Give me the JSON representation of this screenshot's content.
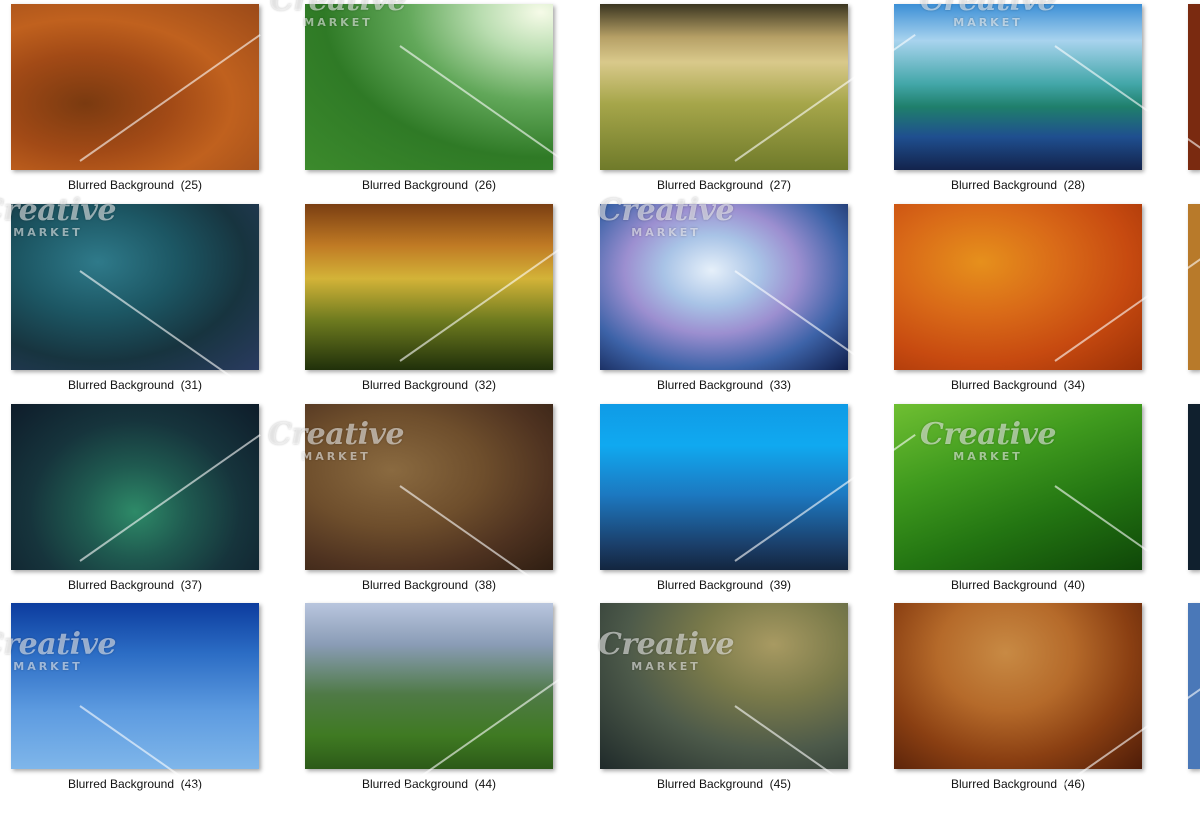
{
  "gallery": {
    "items": [
      {
        "label": "Blurred Background  (25)",
        "gradient": "radial-gradient(ellipse at 30% 60%, #7a3a10 0%, #a24a16 35%, #c0611e 60%, #9b4a19 100%)"
      },
      {
        "label": "Blurred Background  (26)",
        "gradient": "radial-gradient(ellipse at 95% 5%, #f6fbe8 0%, #b9ddb0 18%, #62a85a 40%, #2f7a26 65%, #3c8a2c 100%)"
      },
      {
        "label": "Blurred Background  (27)",
        "gradient": "linear-gradient(180deg, #3a3520 0%, #b6a066 20%, #d9c98b 35%, #a6a64a 60%, #6f7a2a 100%)"
      },
      {
        "label": "Blurred Background  (28)",
        "gradient": "linear-gradient(180deg, #3c8fd6 0%, #a8d3ee 22%, #43a7a9 48%, #1f7f6b 62%, #1f4f8f 80%, #13234c 100%)"
      },
      {
        "label": "Blurred Background  (31)",
        "gradient": "radial-gradient(ellipse at 35% 35%, #2f7a8a 0%, #1c5663 35%, #17343f 65%, #2a3b60 100%)"
      },
      {
        "label": "Blurred Background  (32)",
        "gradient": "linear-gradient(180deg, #7a3e12 0%, #c07a24 25%, #d3b338 45%, #6e7b1f 70%, #20300a 100%)"
      },
      {
        "label": "Blurred Background  (33)",
        "gradient": "radial-gradient(ellipse at 45% 40%, #e6f0fa 0%, #a8c3e6 25%, #9c8fd0 45%, #3d63a8 70%, #0f1d4a 100%)"
      },
      {
        "label": "Blurred Background  (34)",
        "gradient": "radial-gradient(ellipse at 35% 35%, #e6901c 0%, #d96a18 35%, #c74a10 65%, #9a3006 100%)"
      },
      {
        "label": "Blurred Background  (37)",
        "gradient": "radial-gradient(ellipse at 50% 65%, #2e8a68 0%, #1f5a50 30%, #16343c 60%, #0e1c2a 100%)"
      },
      {
        "label": "Blurred Background  (38)",
        "gradient": "radial-gradient(ellipse at 35% 40%, #8a6a40 0%, #6e4e2c 40%, #4e3220 70%, #2f1e12 100%)"
      },
      {
        "label": "Blurred Background  (39)",
        "gradient": "linear-gradient(180deg, #0f9be6 0%, #10a9f0 25%, #1c78c0 55%, #1b3f6a 85%, #13263f 100%)"
      },
      {
        "label": "Blurred Background  (40)",
        "gradient": "linear-gradient(160deg, #6fbf32 0%, #3f9a1e 35%, #237512 65%, #0f4708 100%)"
      },
      {
        "label": "Blurred Background  (43)",
        "gradient": "linear-gradient(180deg, #0c3c9e 0%, #2b6cc4 30%, #5d9be0 65%, #7fb6ea 100%)"
      },
      {
        "label": "Blurred Background  (44)",
        "gradient": "linear-gradient(180deg, #b9c6de 0%, #8a9cb6 25%, #4f7a46 55%, #3f7a22 80%, #2c5a18 100%)"
      },
      {
        "label": "Blurred Background  (45)",
        "gradient": "radial-gradient(ellipse at 70% 25%, #a89a62 0%, #7a7a4a 30%, #4d5a4a 60%, #1f2a2a 100%)"
      },
      {
        "label": "Blurred Background  (46)",
        "gradient": "radial-gradient(ellipse at 45% 30%, #c88a44 0%, #b56a2a 35%, #8a3f12 65%, #4e1c08 100%)"
      }
    ],
    "watermark": {
      "line1": "Creative",
      "line2": "MARKET"
    }
  }
}
